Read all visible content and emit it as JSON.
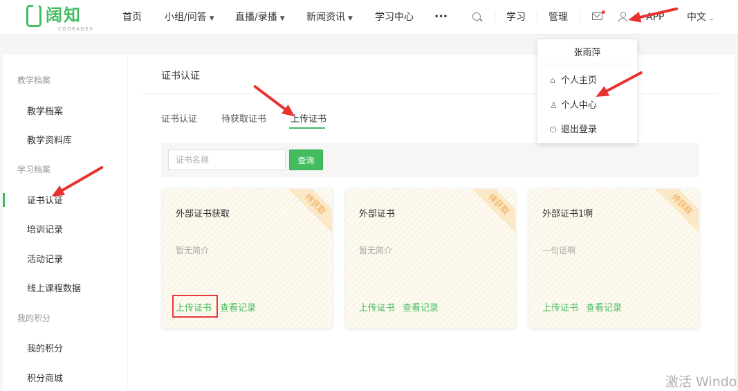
{
  "header": {
    "logo_text": "阔知",
    "logo_sub": "CODEAGES",
    "nav": [
      {
        "label": "首页"
      },
      {
        "label": "小组/问答"
      },
      {
        "label": "直播/录播"
      },
      {
        "label": "新闻资讯"
      },
      {
        "label": "学习中心"
      },
      {
        "label": "•••"
      }
    ],
    "study": "学习",
    "manage": "管理",
    "app": "APP",
    "lang": "中文"
  },
  "sidebar": {
    "group1": "教学档案",
    "item1": "教学档案",
    "item2": "教学资料库",
    "group2": "学习档案",
    "item3": "证书认证",
    "item4": "培训记录",
    "item5": "活动记录",
    "item6": "线上课程数据",
    "group3": "我的积分",
    "item7": "我的积分",
    "item8": "积分商城"
  },
  "main": {
    "title": "证书认证",
    "tabs": [
      "证书认证",
      "待获取证书",
      "上传证书"
    ],
    "search_placeholder": "证书名称",
    "search_button": "查询",
    "cards": [
      {
        "title": "外部证书获取",
        "desc": "暂无简介",
        "badge": "待获取",
        "upload": "上传证书",
        "records": "查看记录"
      },
      {
        "title": "外部证书",
        "desc": "暂无简介",
        "badge": "待获取",
        "upload": "上传证书",
        "records": "查看记录"
      },
      {
        "title": "外部证书1啊",
        "desc": "一句话啊",
        "badge": "待获取",
        "upload": "上传证书",
        "records": "查看记录"
      }
    ]
  },
  "dropdown": {
    "username": "张雨萍",
    "home": "个人主页",
    "center": "个人中心",
    "logout": "退出登录"
  },
  "watermark": "激活 Windo"
}
